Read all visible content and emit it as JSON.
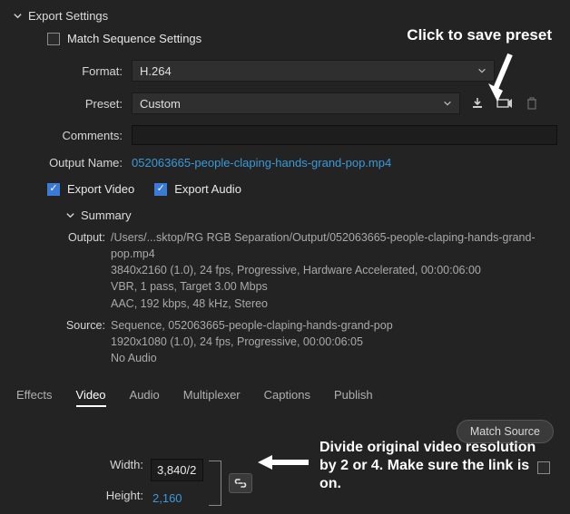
{
  "header": {
    "title": "Export Settings"
  },
  "matchSequence": {
    "label": "Match Sequence Settings",
    "checked": false
  },
  "format": {
    "label": "Format:",
    "value": "H.264"
  },
  "preset": {
    "label": "Preset:",
    "value": "Custom"
  },
  "comments": {
    "label": "Comments:",
    "value": ""
  },
  "outputName": {
    "label": "Output Name:",
    "value": "052063665-people-claping-hands-grand-pop.mp4"
  },
  "exportVideo": {
    "label": "Export Video",
    "checked": true
  },
  "exportAudio": {
    "label": "Export Audio",
    "checked": true
  },
  "summary": {
    "title": "Summary",
    "output": {
      "label": "Output:",
      "lines": [
        "/Users/...sktop/RG RGB Separation/Output/052063665-people-claping-hands-grand-pop.mp4",
        "3840x2160 (1.0), 24 fps, Progressive, Hardware Accelerated, 00:00:06:00",
        "VBR, 1 pass, Target 3.00 Mbps",
        "AAC, 192 kbps, 48 kHz, Stereo"
      ]
    },
    "source": {
      "label": "Source:",
      "lines": [
        "Sequence, 052063665-people-claping-hands-grand-pop",
        "1920x1080 (1.0), 24 fps, Progressive, 00:00:06:05",
        "No Audio"
      ]
    }
  },
  "tabs": [
    "Effects",
    "Video",
    "Audio",
    "Multiplexer",
    "Captions",
    "Publish"
  ],
  "activeTab": "Video",
  "matchSourceBtn": "Match Source",
  "dimensions": {
    "widthLabel": "Width:",
    "heightLabel": "Height:",
    "widthValue": "3,840/2",
    "heightValue": "2,160"
  },
  "annotations": {
    "savePreset": "Click to save preset",
    "divide": "Divide original video resolution by 2 or 4. Make sure the link is on."
  }
}
